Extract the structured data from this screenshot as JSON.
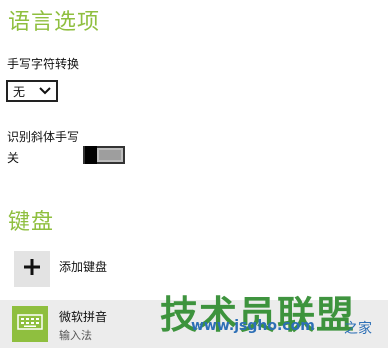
{
  "language_options": {
    "title": "语言选项",
    "handwriting_label": "手写字符转换",
    "handwriting_value": "无",
    "cursive_label": "识别斜体手写",
    "cursive_state": "关"
  },
  "keyboard": {
    "title": "键盘",
    "add_label": "添加键盘",
    "item_name": "微软拼音",
    "item_subtitle": "输入法"
  },
  "watermark": {
    "brand": "技术员联盟",
    "url": "www.jsgho.com",
    "suffix": "之家"
  },
  "colors": {
    "accent": "#8fbf3f",
    "watermark_green": "#2f8c2f",
    "watermark_blue": "#2d6fb6"
  },
  "icons": {
    "dropdown": "chevron-down-icon",
    "add": "plus-icon",
    "keyboard": "keyboard-icon"
  }
}
